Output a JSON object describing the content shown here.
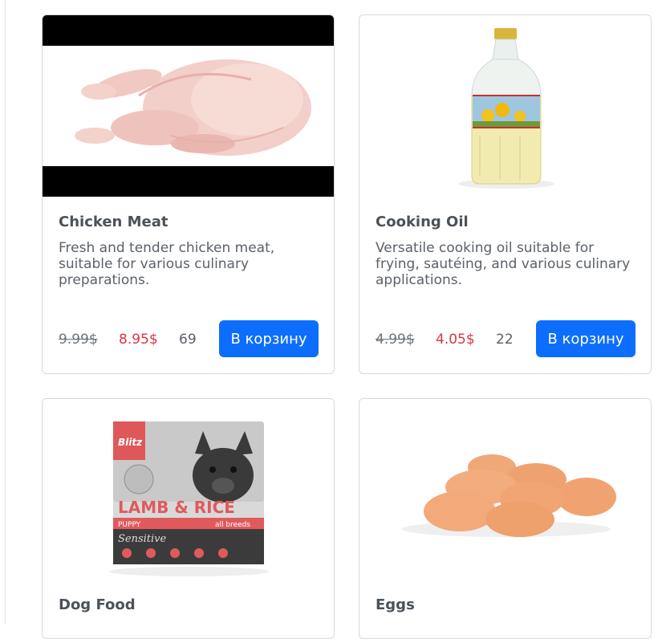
{
  "products": [
    {
      "name": "Chicken Meat",
      "description": "Fresh and tender chicken meat, suitable for various culinary preparations.",
      "old_price": "9.99$",
      "new_price": "8.95$",
      "quantity": "69",
      "button_label": "В корзину"
    },
    {
      "name": "Cooking Oil",
      "description": "Versatile cooking oil suitable for frying, sautéing, and various culinary applications.",
      "old_price": "4.99$",
      "new_price": "4.05$",
      "quantity": "22",
      "button_label": "В корзину"
    },
    {
      "name": "Dog Food",
      "image_text": {
        "brand": "Blitz",
        "line1": "LAMB & RICE",
        "line2": "PUPPY",
        "line3": "all breeds",
        "line4": "Sensitive"
      }
    },
    {
      "name": "Eggs"
    }
  ],
  "colors": {
    "accent": "#0d6efd",
    "sale_price": "#dc3545"
  }
}
